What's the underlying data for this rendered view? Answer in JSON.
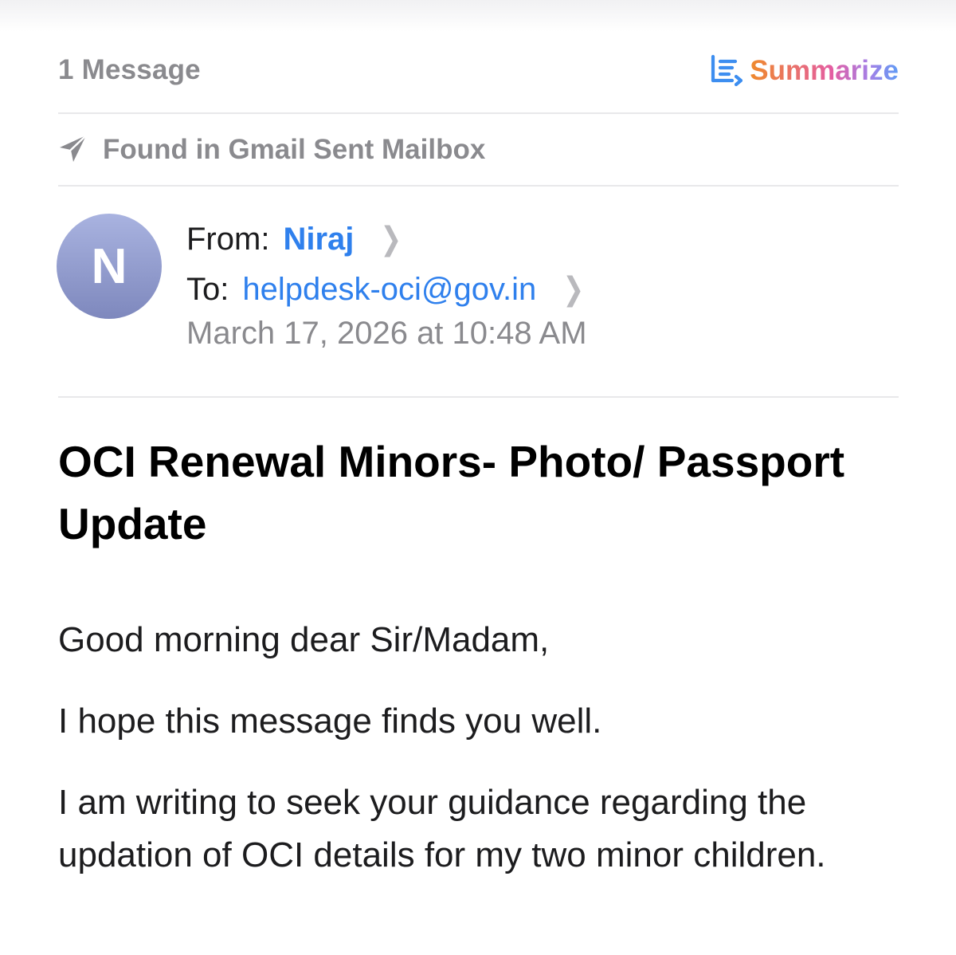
{
  "header": {
    "message_count": "1 Message",
    "summarize_label": "Summarize",
    "summarize_icon": "summarize-lines-icon",
    "colors": {
      "summarize_gradient": [
        "#ef8a2b",
        "#e45da2",
        "#a57fe6",
        "#5f9cf5"
      ],
      "summarize_icon": "#3d8ef0"
    }
  },
  "mailbox": {
    "icon": "paper-plane-icon",
    "label": "Found in Gmail Sent Mailbox"
  },
  "sender": {
    "avatar_letter": "N",
    "from_label": "From:",
    "from_name": "Niraj",
    "to_label": "To:",
    "to_address": "helpdesk-oci@gov.in",
    "date": "March 17, 2026 at 10:48 AM",
    "colors": {
      "link": "#2f80ed",
      "avatar_top": "#a9b3e0",
      "avatar_bottom": "#7e88bd"
    }
  },
  "message": {
    "subject": "OCI Renewal Minors- Photo/ Passport Update",
    "paragraphs": [
      "Good morning dear Sir/Madam,",
      "I hope this message finds you well.",
      "I am writing to seek your guidance regarding the updation of OCI details for my two minor children."
    ]
  }
}
